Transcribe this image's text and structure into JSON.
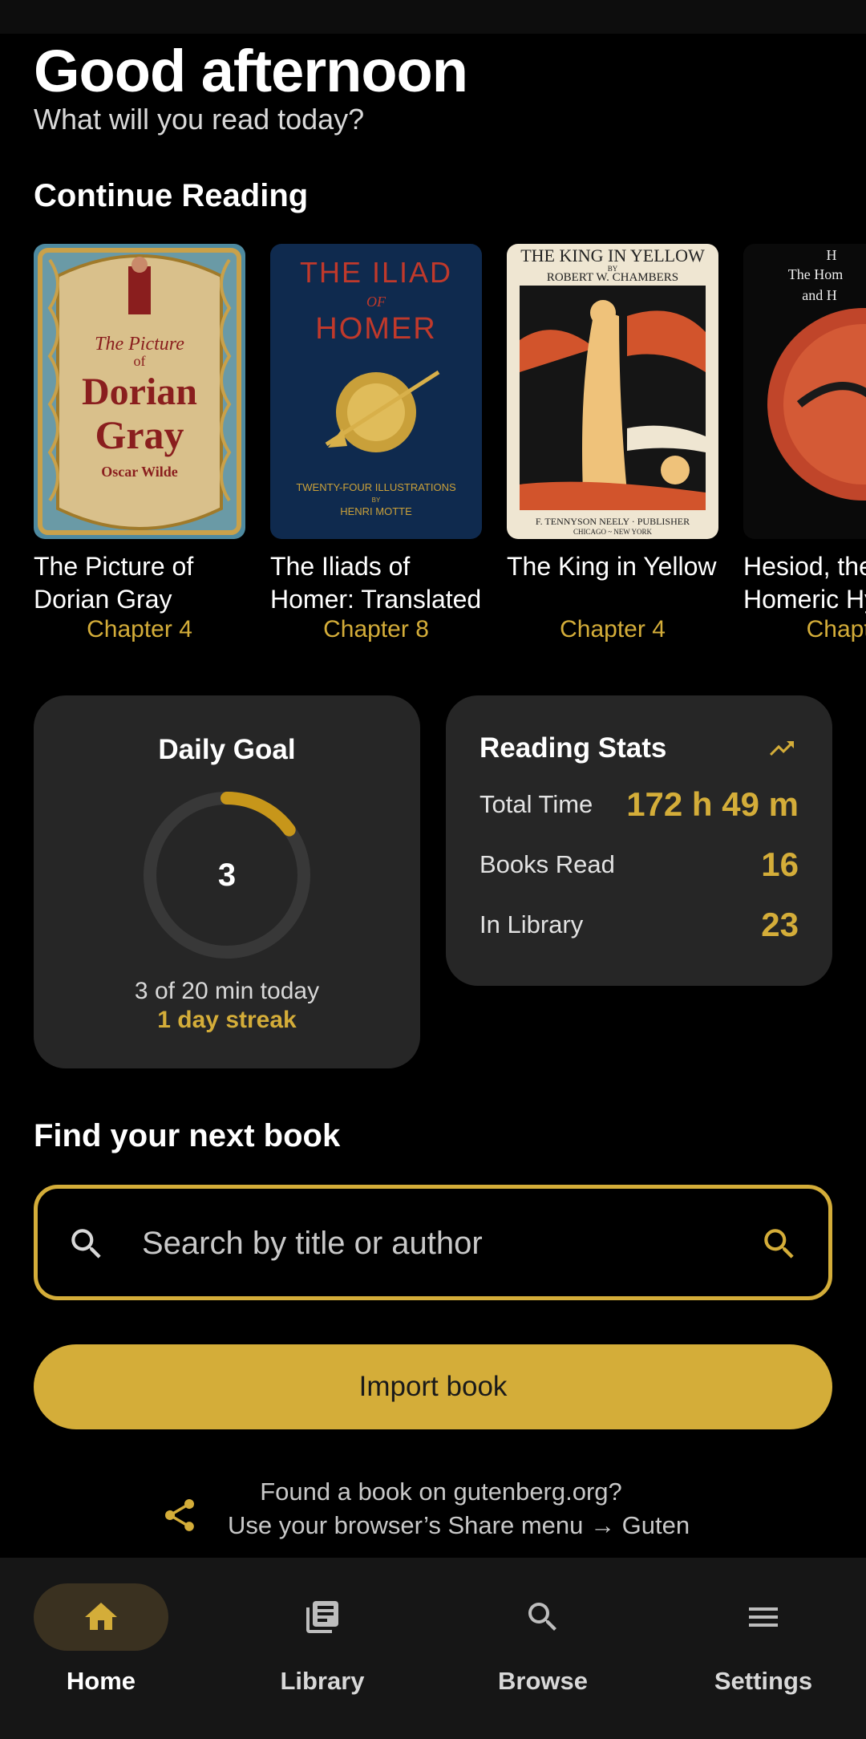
{
  "header": {
    "greeting": "Good afternoon",
    "subtitle": "What will you read today?"
  },
  "continue_reading": {
    "title": "Continue Reading",
    "books": [
      {
        "title": "The Picture of Dorian Gray",
        "chapter": "Chapter 4",
        "cover_text": [
          "The Picture",
          "of",
          "Dorian",
          "Gray",
          "Oscar Wilde"
        ]
      },
      {
        "title": "The Iliads of Homer: Translated",
        "chapter": "Chapter 8",
        "cover_text": [
          "THE ILIAD",
          "OF",
          "HOMER",
          "TWENTY-FOUR ILLUSTRATIONS",
          "BY",
          "HENRI MOTTE"
        ]
      },
      {
        "title": "The King in Yellow",
        "chapter": "Chapter 4",
        "cover_text": [
          "THE KING IN YELLOW",
          "BY",
          "ROBERT W. CHAMBERS",
          "F. TENNYSON NEELY · PUBLISHER",
          "CHICAGO ~ NEW YORK"
        ]
      },
      {
        "title": "Hesiod, the Homeric Hymns",
        "chapter": "Chapter",
        "cover_text": [
          "H",
          "The Hom",
          "and H"
        ]
      }
    ]
  },
  "daily_goal": {
    "title": "Daily Goal",
    "minutes_read": "3",
    "progress_fraction": 0.15,
    "progress_text": "3 of 20 min today",
    "streak_text": "1 day streak"
  },
  "reading_stats": {
    "title": "Reading Stats",
    "icon": "trending-up-icon",
    "rows": [
      {
        "label": "Total Time",
        "value": "172 h 49 m"
      },
      {
        "label": "Books Read",
        "value": "16"
      },
      {
        "label": "In Library",
        "value": "23"
      }
    ]
  },
  "discover": {
    "title": "Find your next book",
    "search_placeholder": "Search by title or author",
    "import_label": "Import book",
    "hint_line1": "Found a book on gutenberg.org?",
    "hint_line2": "Use your browser’s Share menu → Guten"
  },
  "nav": {
    "items": [
      {
        "label": "Home",
        "icon": "home-icon",
        "active": true
      },
      {
        "label": "Library",
        "icon": "library-icon",
        "active": false
      },
      {
        "label": "Browse",
        "icon": "search-icon",
        "active": false
      },
      {
        "label": "Settings",
        "icon": "menu-icon",
        "active": false
      }
    ]
  },
  "colors": {
    "accent": "#d4ad39",
    "background": "#000000",
    "card": "#262626",
    "nav_background": "#161616"
  }
}
